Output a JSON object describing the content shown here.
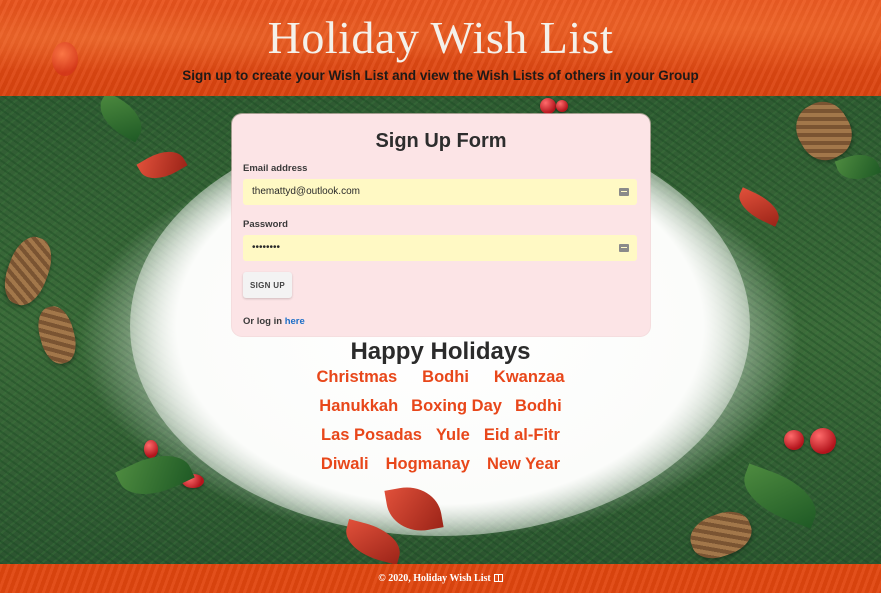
{
  "header": {
    "title": "Holiday Wish List",
    "subtitle": "Sign up to create your Wish List and view the Wish Lists of others in your Group"
  },
  "signup_form": {
    "title": "Sign Up Form",
    "email_label": "Email address",
    "email_value": "themattyd@outlook.com",
    "password_label": "Password",
    "password_value": "••••••••",
    "signup_button_label": "SIGN UP",
    "login_prefix": "Or log in",
    "login_link_text": "here"
  },
  "holidays": {
    "title": "Happy Holidays",
    "rows": [
      [
        "Christmas",
        "Bodhi",
        "Kwanzaa"
      ],
      [
        "Hanukkah",
        "Boxing Day",
        "Bodhi"
      ],
      [
        "Las Posadas",
        "Yule",
        "Eid al-Fitr"
      ],
      [
        "Diwali",
        "Hogmanay",
        "New Year"
      ]
    ]
  },
  "footer": {
    "copyright": "© 2020, Holiday Wish List"
  },
  "colors": {
    "header_orange": "#e04a14",
    "form_background": "#fce4e6",
    "input_background": "#fff9c4",
    "holiday_text": "#e8471a",
    "link_blue": "#1e6fc7"
  }
}
